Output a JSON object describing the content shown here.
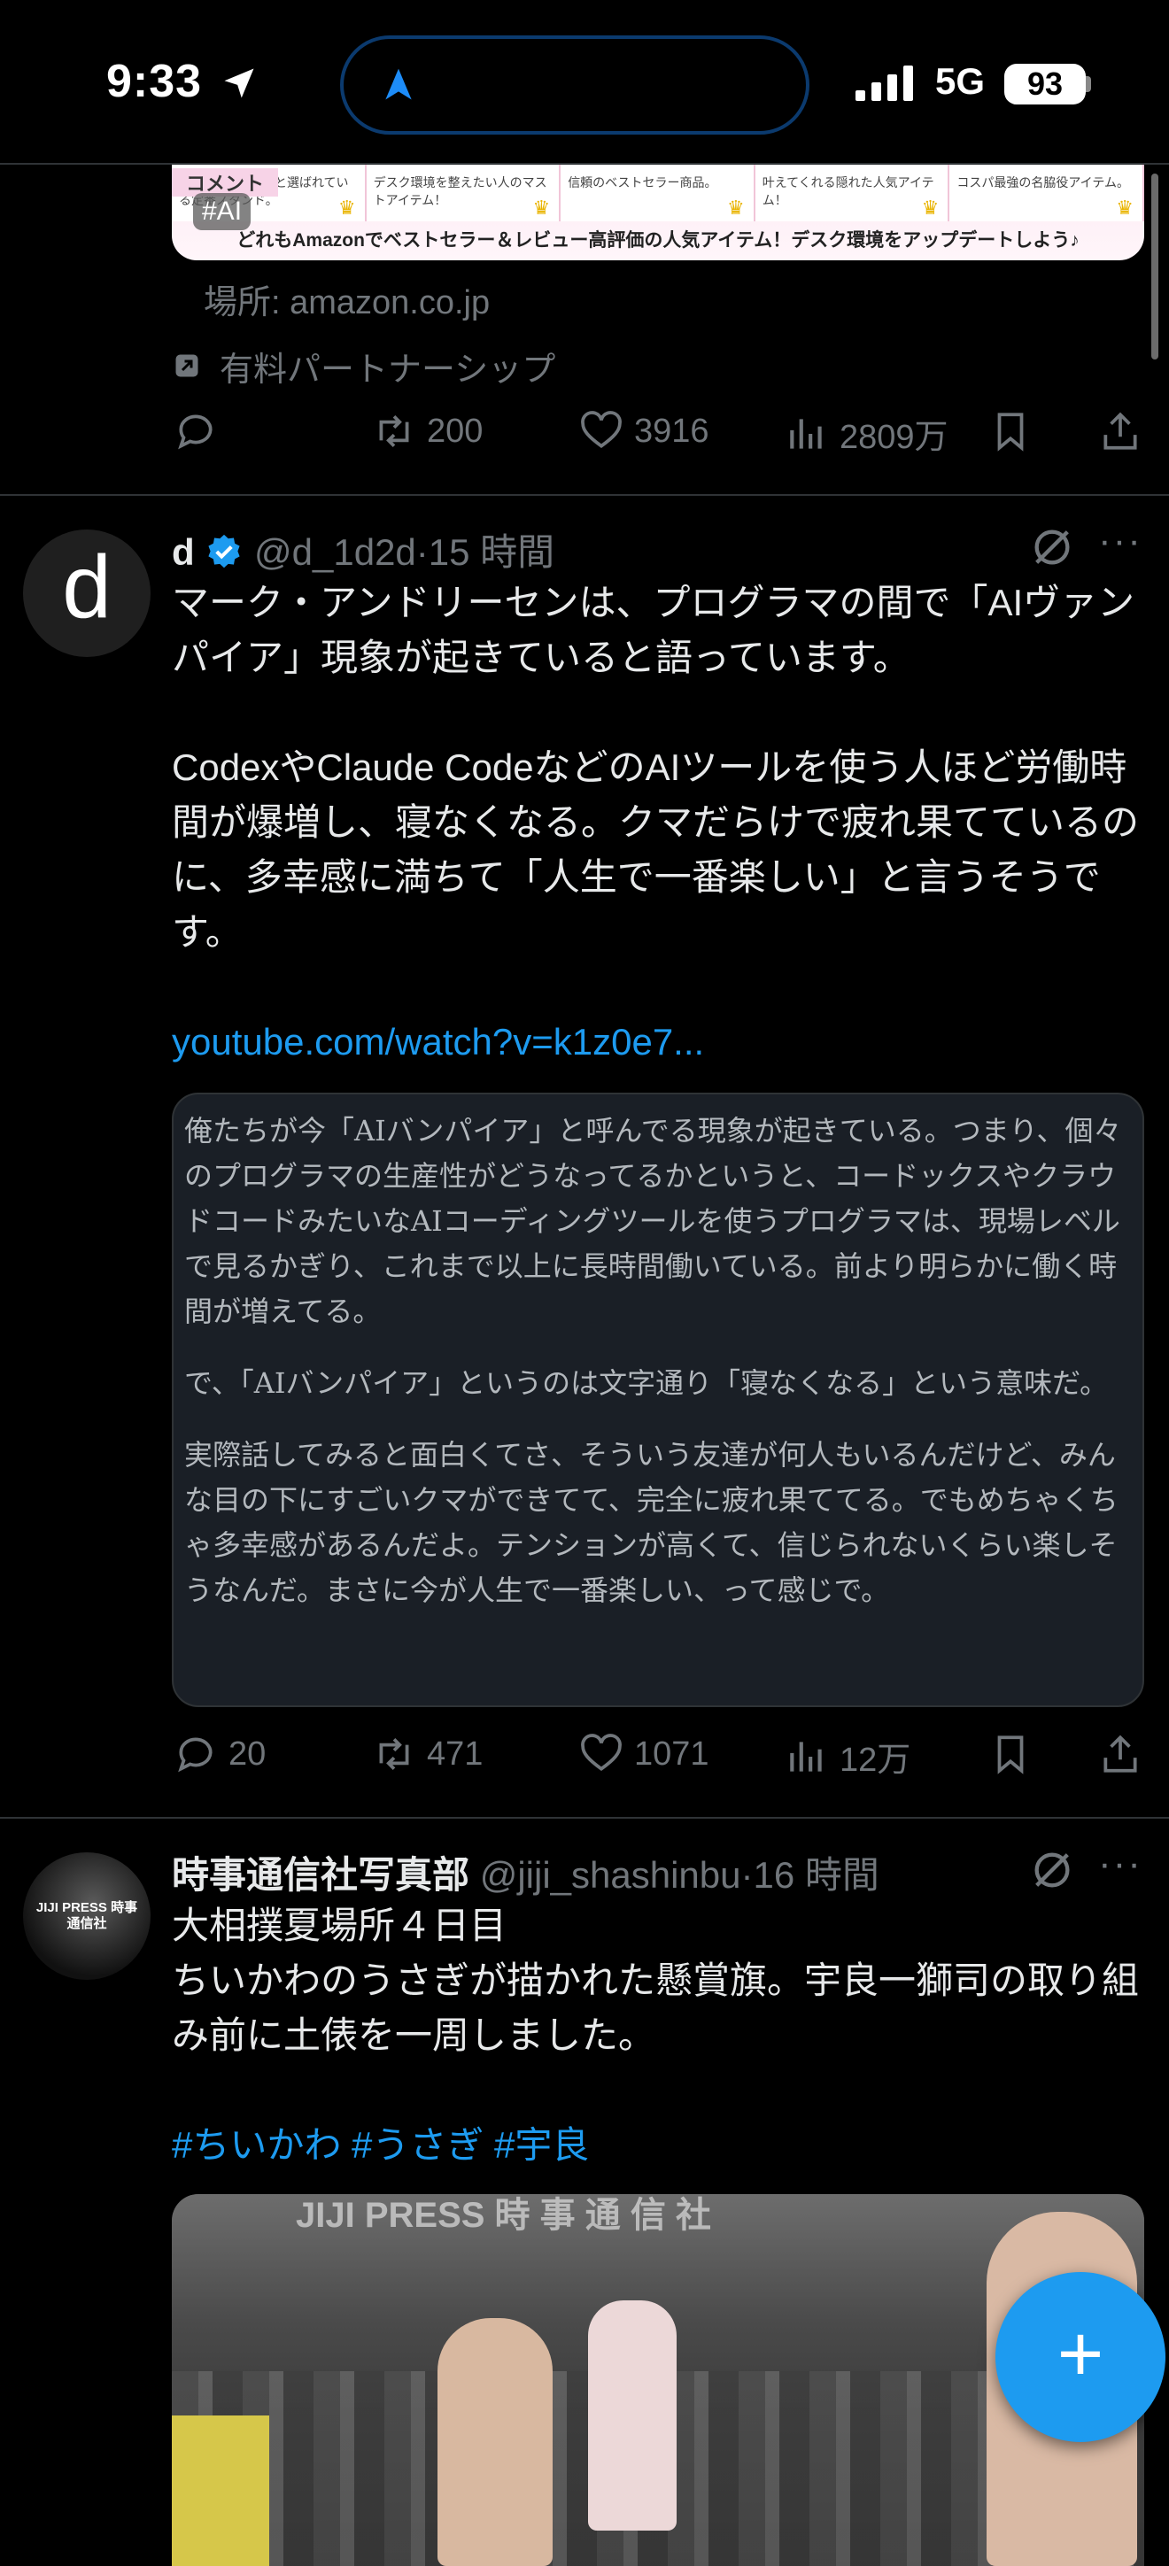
{
  "status_bar": {
    "time": "9:33",
    "network": "5G",
    "battery": "93"
  },
  "ad_card": {
    "tag": "#AI",
    "label": "コメント",
    "cells": [
      "\"とりあえずこれ\"と選ばれている定番スタンド。",
      "デスク環境を整えたい人のマストアイテム！",
      "信頼のベストセラー商品。",
      "叶えてくれる隠れた人気アイテム！",
      "コスパ最強の名脇役アイテム。"
    ],
    "bottom_text": "どれもAmazonでベストセラー＆レビュー高評価の人気アイテム！デスク環境をアップデートしよう♪",
    "source": "場所: amazon.co.jp",
    "paid_label": "有料パートナーシップ",
    "actions": {
      "retweets": "200",
      "likes": "3916",
      "views": "2809万"
    }
  },
  "tweet1": {
    "avatar_letter": "d",
    "name": "d",
    "handle": "@d_1d2d",
    "time": "15 時間",
    "text_p1": "マーク・アンドリーセンは、プログラマの間で「AIヴァンパイア」現象が起きていると語っています。",
    "text_p2": "CodexやClaude CodeなどのAIツールを使う人ほど労働時間が爆増し、寝なくなる。クマだらけで疲れ果てているのに、多幸感に満ちて「人生で一番楽しい」と言うそうです。",
    "link": "youtube.com/watch?v=k1z0e7...",
    "quote_p1": "俺たちが今「AIバンパイア」と呼んでる現象が起きている。つまり、個々のプログラマの生産性がどうなってるかというと、コードックスやクラウドコードみたいなAIコーディングツールを使うプログラマは、現場レベルで見るかぎり、これまで以上に長時間働いている。前より明らかに働く時間が増えてる。",
    "quote_p2": "で、「AIバンパイア」というのは文字通り「寝なくなる」という意味だ。",
    "quote_p3": "実際話してみると面白くてさ、そういう友達が何人もいるんだけど、みんな目の下にすごいクマができてて、完全に疲れ果ててる。でもめちゃくちゃ多幸感があるんだよ。テンションが高くて、信じられないくらい楽しそうなんだ。まさに今が人生で一番楽しい、って感じで。",
    "actions": {
      "replies": "20",
      "retweets": "471",
      "likes": "1071",
      "views": "12万"
    }
  },
  "tweet2": {
    "name": "時事通信社写真部",
    "handle": "@jiji_shashinbu",
    "time": "16 時間",
    "line1": "大相撲夏場所４日目",
    "line2": "ちいかわのうさぎが描かれた懸賞旗。宇良一獅司の取り組み前に土俵を一周しました。",
    "hashtags": "#ちいかわ #うさぎ #宇良",
    "avatar_text": "JIJI PRESS 時事通信社",
    "watermark": "JIJI PRESS 時 事 通 信 社"
  },
  "colors": {
    "accent": "#1d9bf0",
    "background": "#000000",
    "muted": "#71767b"
  }
}
